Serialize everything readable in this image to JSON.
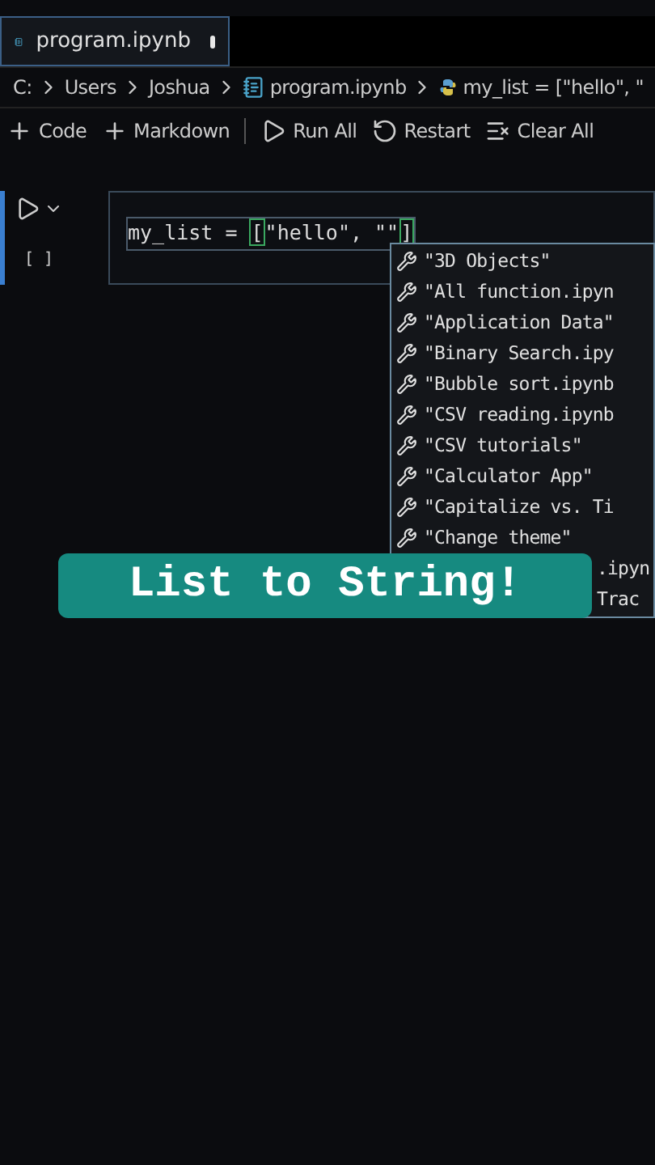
{
  "tab": {
    "title": "program.ipynb",
    "modified": true,
    "selected": true
  },
  "breadcrumb": [
    "C:",
    "Users",
    "Joshua",
    "program.ipynb",
    "my_list = [\"hello\", \""
  ],
  "toolbar": [
    {
      "kind": "plus",
      "label": "Code"
    },
    {
      "kind": "plus",
      "label": "Markdown"
    },
    {
      "kind": "run",
      "label": "Run All"
    },
    {
      "kind": "restart",
      "label": "Restart"
    },
    {
      "kind": "clear",
      "label": "Clear All"
    }
  ],
  "cell": {
    "code_start": "my_list = ",
    "open": "[",
    "string": "\"hello\", \"\"",
    "close": "]",
    "execution_count": "[ ]"
  },
  "suggestions": [
    {
      "label": "\"3D Objects\""
    },
    {
      "label": "\"All function.ipyn"
    },
    {
      "label": "\"Application Data\""
    },
    {
      "label": "\"Binary Search.ipy"
    },
    {
      "label": "\"Bubble sort.ipynb"
    },
    {
      "label": "\"CSV reading.ipynb"
    },
    {
      "label": "\"CSV tutorials\""
    },
    {
      "label": "\"Calculator App\""
    },
    {
      "label": "\"Capitalize vs. Ti"
    },
    {
      "label": "\"Change theme\""
    },
    {
      "label": ".ipyn",
      "kind": "partial"
    },
    {
      "label": "Trac",
      "kind": "partial"
    }
  ],
  "caption": "List to String!"
}
